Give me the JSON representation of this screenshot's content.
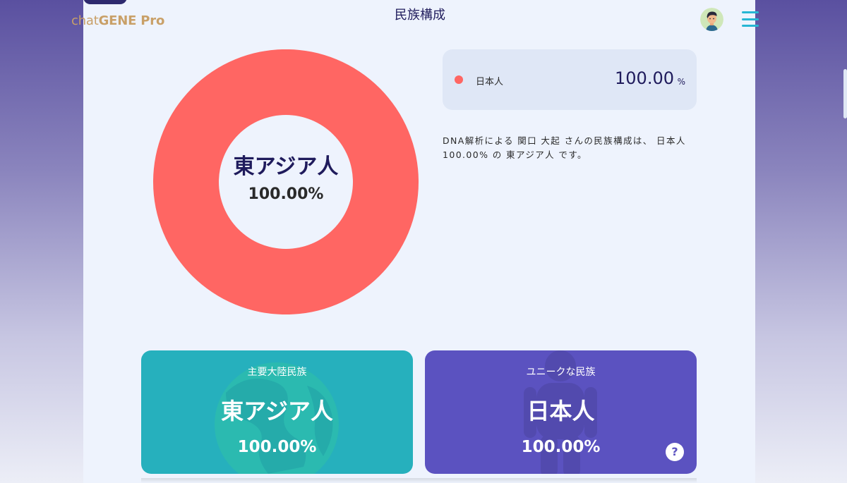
{
  "header": {
    "logo_light": "chat",
    "logo_bold": "GENE Pro",
    "title": "民族構成"
  },
  "icons": {
    "avatar": "user-avatar",
    "menu": "hamburger-menu-icon",
    "help": "question-icon"
  },
  "colors": {
    "east_asian": "#ff6663",
    "teal_card": "#26b0bd",
    "purple_card": "#5b52c0",
    "title_navy": "#1f1b5c",
    "accent": "#27b6d4"
  },
  "donut": {
    "label": "東アジア人",
    "value_text": "100.00%"
  },
  "legend": {
    "items": [
      {
        "name": "日本人",
        "value": "100.00",
        "unit": "%"
      }
    ]
  },
  "description": "DNA解析による 関口 大起 さんの民族構成は、 日本人 100.00% の 東アジア人 です。",
  "cards": {
    "continental": {
      "label": "主要大陸民族",
      "name": "東アジア人",
      "value": "100.00%"
    },
    "unique": {
      "label": "ユニークな民族",
      "name": "日本人",
      "value": "100.00%",
      "help": "?"
    }
  },
  "chart_data": {
    "type": "pie",
    "categories": [
      "東アジア人"
    ],
    "values": [
      100.0
    ]
  }
}
